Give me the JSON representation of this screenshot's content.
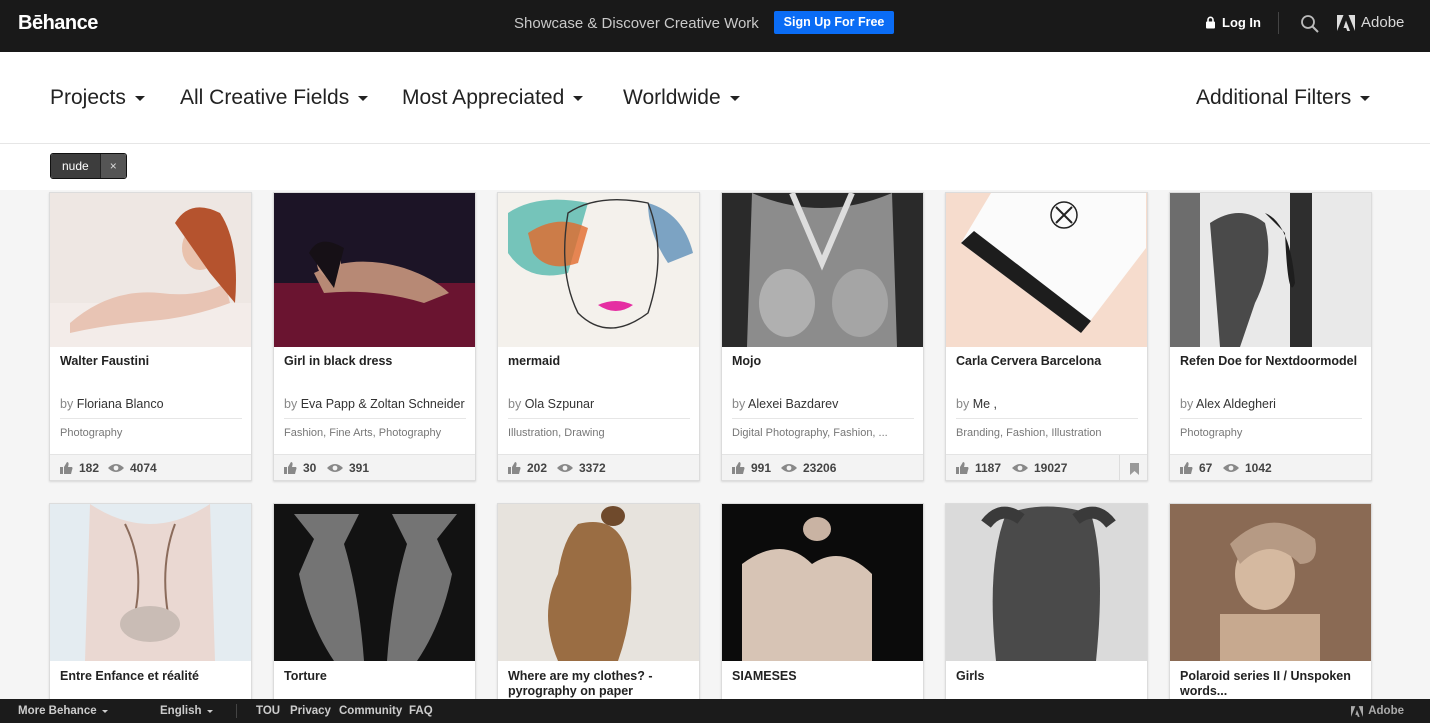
{
  "header": {
    "logo": "Bēhance",
    "tagline": "Showcase & Discover Creative Work",
    "signup_label": "Sign Up For Free",
    "login_label": "Log In",
    "adobe_label": "Adobe"
  },
  "filters": {
    "projects": "Projects",
    "fields": "All Creative Fields",
    "sort": "Most Appreciated",
    "location": "Worldwide",
    "additional": "Additional Filters"
  },
  "search_tag": {
    "label": "nude",
    "remove": "×"
  },
  "projects_row1": [
    {
      "title": "Walter Faustini",
      "by": "by",
      "owner": "Floriana Blanco",
      "fields": "Photography",
      "appreciations": "182",
      "views": "4074"
    },
    {
      "title": "Girl in black dress",
      "by": "by",
      "owner": "Eva Papp & Zoltan Schneider",
      "fields": "Fashion, Fine Arts, Photography",
      "appreciations": "30",
      "views": "391"
    },
    {
      "title": "mermaid",
      "by": "by",
      "owner": "Ola Szpunar",
      "fields": "Illustration, Drawing",
      "appreciations": "202",
      "views": "3372"
    },
    {
      "title": "Mojo",
      "by": "by",
      "owner": "Alexei Bazdarev",
      "fields": "Digital Photography, Fashion, ...",
      "appreciations": "991",
      "views": "23206"
    },
    {
      "title": "Carla Cervera Barcelona",
      "by": "by",
      "owner": "Me ,",
      "fields": "Branding, Fashion, Illustration",
      "appreciations": "1187",
      "views": "19027"
    },
    {
      "title": "Refen Doe for Nextdoormodel",
      "by": "by",
      "owner": "Alex Aldegheri",
      "fields": "Photography",
      "appreciations": "67",
      "views": "1042"
    }
  ],
  "projects_row2": [
    {
      "title": "Entre Enfance et réalité"
    },
    {
      "title": "Torture"
    },
    {
      "title": "Where are my clothes? - pyrography on paper"
    },
    {
      "title": "SIAMESES"
    },
    {
      "title": "Girls"
    },
    {
      "title": "Polaroid series II / Unspoken words..."
    }
  ],
  "footer": {
    "more": "More Behance",
    "language": "English",
    "tou": "TOU",
    "privacy": "Privacy",
    "community": "Community",
    "faq": "FAQ",
    "adobe": "Adobe"
  },
  "colors": {
    "topbar": "#191919",
    "signup": "#0a6cf5",
    "footer": "#1b1b1b"
  }
}
